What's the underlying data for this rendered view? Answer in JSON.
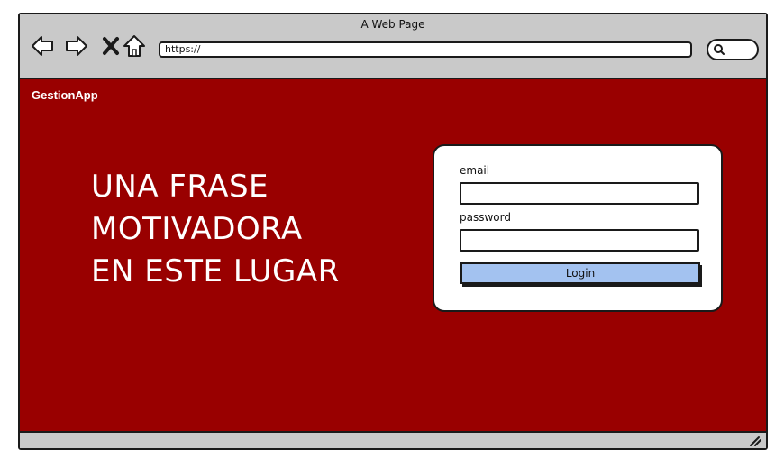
{
  "window": {
    "title": "A Web Page"
  },
  "browser": {
    "nav_icons": [
      "back-icon",
      "forward-icon",
      "close-icon",
      "home-icon"
    ],
    "url": "https://",
    "search_icon": "search-icon"
  },
  "page": {
    "background_color": "#990000",
    "brand": "GestionApp",
    "slogan": [
      "UNA FRASE",
      "MOTIVADORA",
      "EN ESTE LUGAR"
    ]
  },
  "login": {
    "email_label": "email",
    "email_value": "",
    "password_label": "password",
    "password_value": "",
    "button_label": "Login",
    "button_color": "#a3c2f0"
  }
}
